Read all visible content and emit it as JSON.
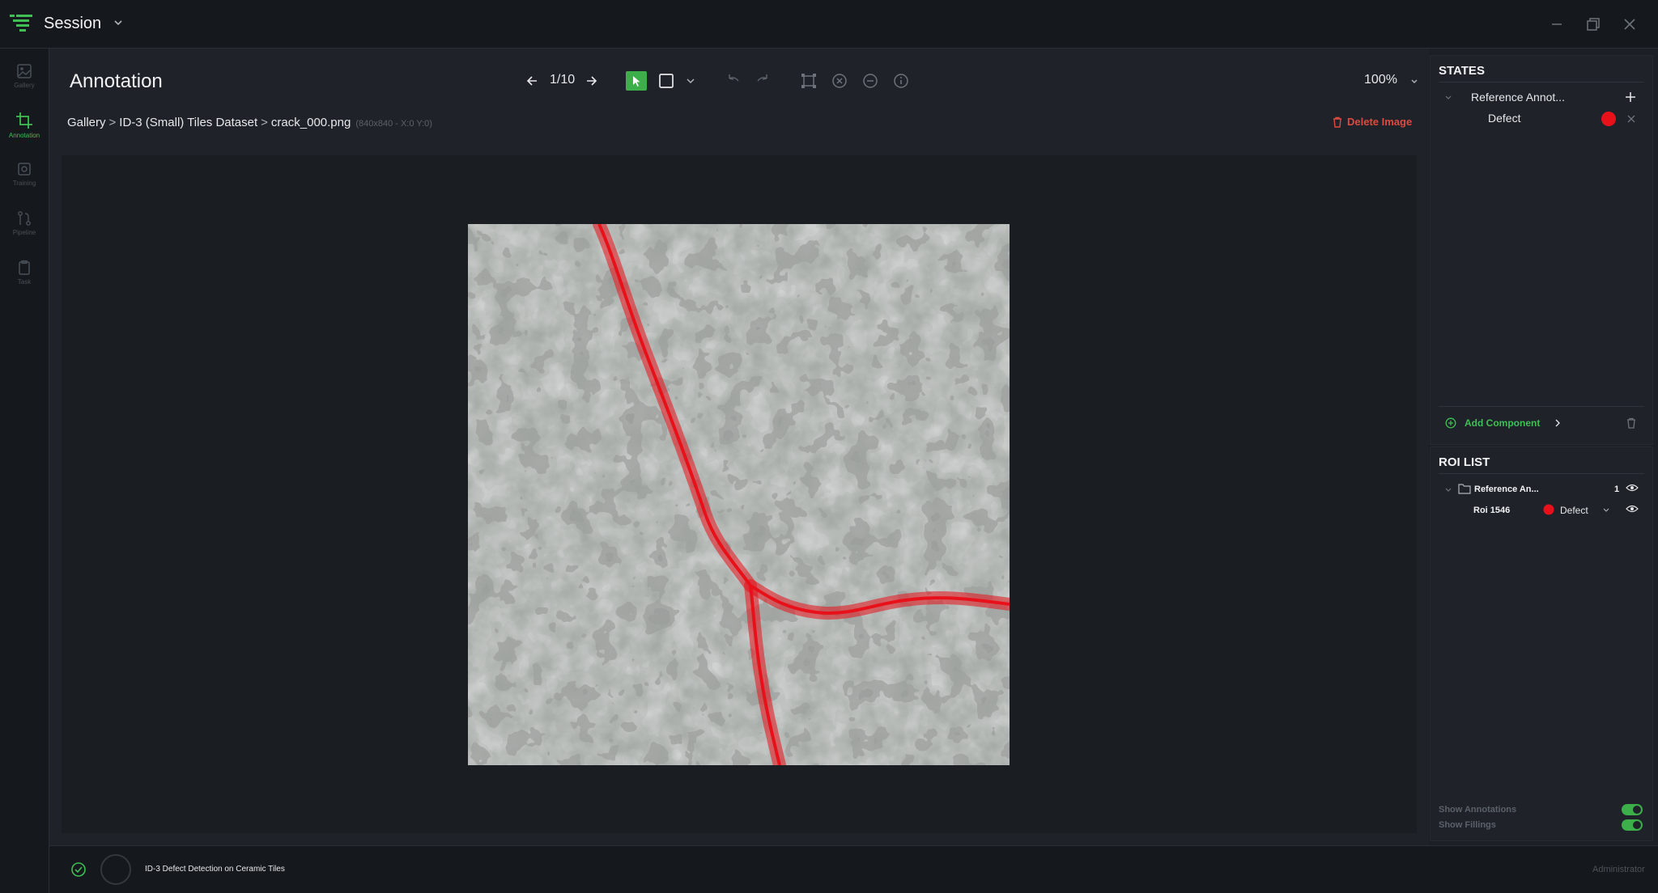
{
  "app": {
    "session_label": "Session"
  },
  "sidebar": {
    "items": [
      {
        "label": "Gallery",
        "icon": "image-icon",
        "active": false
      },
      {
        "label": "Annotation",
        "icon": "crop-icon",
        "active": true
      },
      {
        "label": "Training",
        "icon": "chip-icon",
        "active": false
      },
      {
        "label": "Pipeline",
        "icon": "pipeline-icon",
        "active": false
      },
      {
        "label": "Task",
        "icon": "clipboard-icon",
        "active": false
      }
    ]
  },
  "header": {
    "title": "Annotation",
    "image_counter": "1/10",
    "zoom": "100%"
  },
  "breadcrumb": {
    "gallery": "Gallery",
    "dataset": "ID-3 (Small) Tiles Dataset",
    "file": "crack_000.png",
    "meta": "(840x840 - X:0 Y:0)"
  },
  "actions": {
    "delete_image": "Delete Image"
  },
  "states_panel": {
    "title": "STATES",
    "group": "Reference Annot...",
    "component": "Defect",
    "component_color": "#e8111a",
    "add_component": "Add Component"
  },
  "roi_panel": {
    "title": "ROI LIST",
    "group": "Reference An...",
    "group_count": "1",
    "roi_name": "Roi 1546",
    "roi_class": "Defect",
    "show_annotations": "Show Annotations",
    "show_fillings": "Show Fillings"
  },
  "status": {
    "project": "ID-3 Defect Detection on Ceramic Tiles",
    "user": "Administrator"
  },
  "colors": {
    "accent": "#3cae4a",
    "danger": "#e0493f",
    "annotation": "#e8111a"
  }
}
